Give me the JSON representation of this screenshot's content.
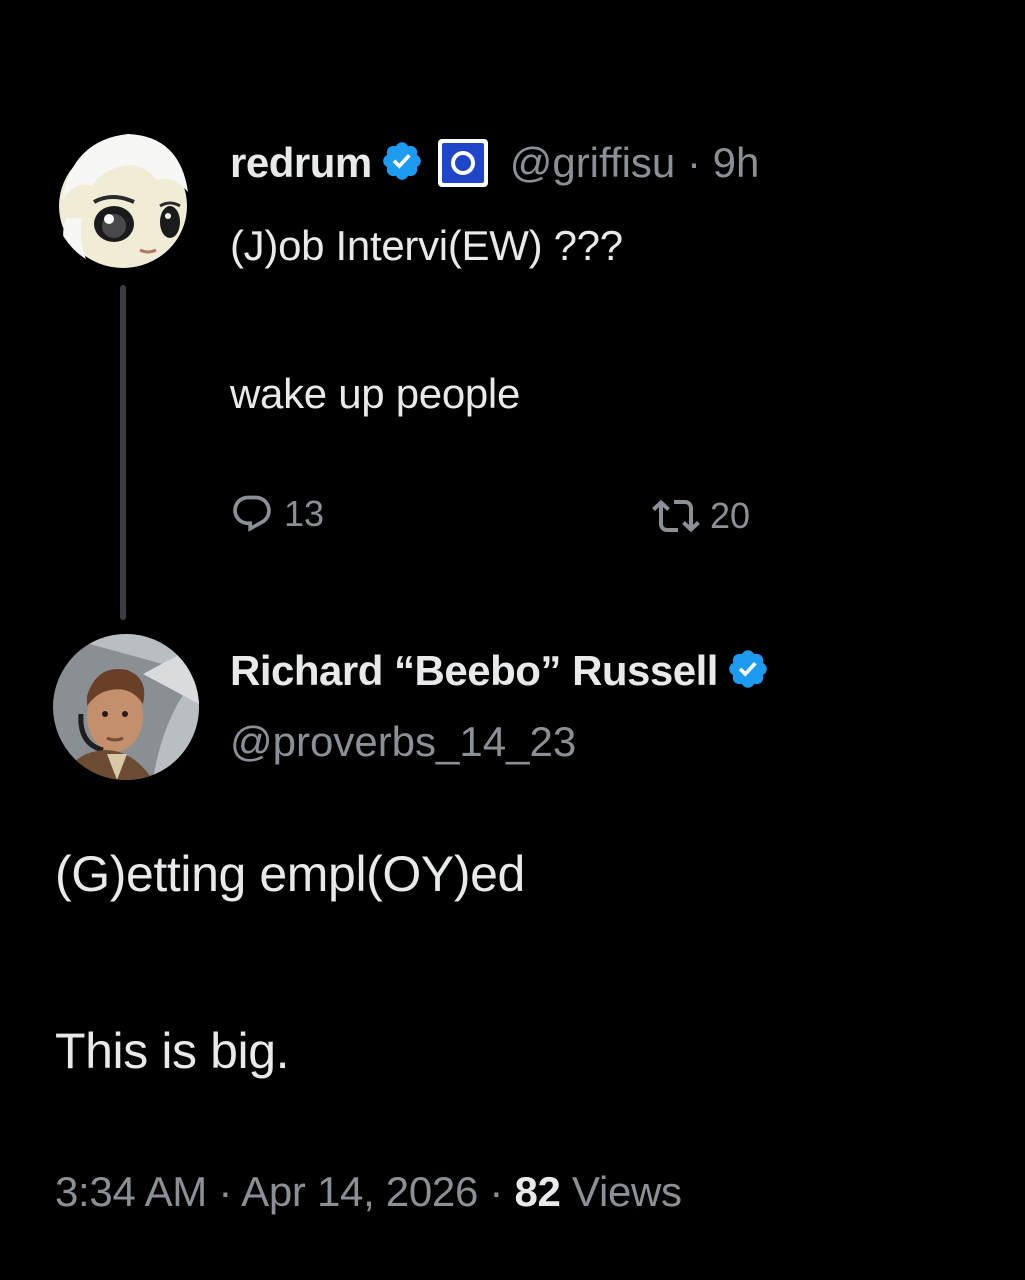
{
  "parent_tweet": {
    "display_name": "redrum",
    "handle": "@griffisu",
    "separator": "·",
    "time_ago": "9h",
    "text_line1": "(J)ob Intervi(EW) ???",
    "text_line2": "wake up people",
    "reply_count": "13",
    "retweet_count": "20",
    "avatar_icon": "anime-doll-avatar",
    "affiliation_icon": "affiliation-badge-icon"
  },
  "reply_tweet": {
    "display_name": "Richard “Beebo” Russell",
    "handle": "@proverbs_14_23",
    "text_line1": "(G)etting empl(OY)ed",
    "text_line2": "This is big.",
    "avatar_icon": "pilot-photo-avatar",
    "timestamp": "3:34 AM",
    "date": "Apr 14, 2026",
    "separator": "·",
    "views_count": "82",
    "views_label": "Views"
  },
  "colors": {
    "background": "#000000",
    "primary_text": "#e7e9ea",
    "secondary_text": "#8b9096",
    "verified_blue": "#1d9bf0",
    "thread_line": "#3a3d41"
  }
}
